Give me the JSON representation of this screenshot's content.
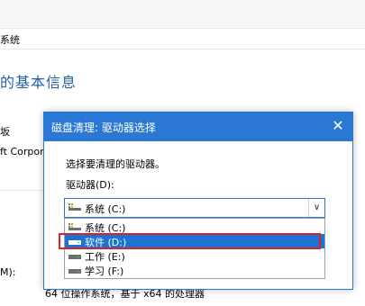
{
  "background": {
    "breadcrumb_text": "系统",
    "heading": "的基本信息",
    "edition_fragment": "坂",
    "copyright_fragment": "ft Corpor",
    "memory_fragment": "M):",
    "system_type": "64 位操作系统，基于 x64 的处理器"
  },
  "dialog": {
    "title": "磁盘清理: 驱动器选择",
    "close_glyph": "✕",
    "prompt": "选择要清理的驱动器。",
    "drive_label": "驱动器(D):",
    "selected_value": "系统 (C:)",
    "arrow_glyph": "∨",
    "options": [
      {
        "label": "系统 (C:)",
        "icon": "windows-drive-icon",
        "selected": false
      },
      {
        "label": "软件 (D:)",
        "icon": "drive-icon",
        "selected": true
      },
      {
        "label": "工作 (E:)",
        "icon": "drive-icon",
        "selected": false
      },
      {
        "label": "学习 (F:)",
        "icon": "drive-icon",
        "selected": false
      }
    ]
  },
  "colors": {
    "accent": "#2b78d4",
    "selection": "#1c74d2",
    "highlight_border": "#d8232a",
    "heading": "#1f5fa7"
  }
}
